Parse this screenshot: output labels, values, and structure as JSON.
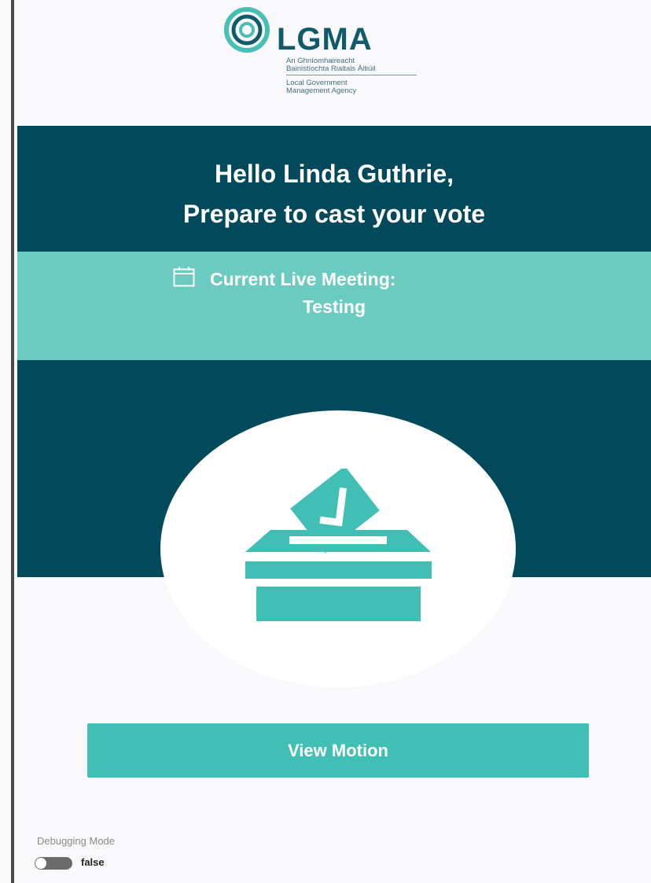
{
  "logo": {
    "name": "LGMA",
    "sub_irish_1": "An Ghníomhaireacht",
    "sub_irish_2": "Bainistíochta Rialtais Áitiúil",
    "sub_english_1": "Local Government",
    "sub_english_2": "Management Agency"
  },
  "greeting": {
    "line1": "Hello Linda Guthrie,",
    "line2": "Prepare to cast your vote"
  },
  "meeting": {
    "label": "Current Live Meeting:",
    "value": "Testing"
  },
  "actions": {
    "view_motion_label": "View Motion"
  },
  "debug": {
    "label": "Debugging Mode",
    "value": "false"
  },
  "icons": {
    "logo": "lgma-logo-mark",
    "calendar": "calendar-icon",
    "ballot": "ballot-box-icon"
  },
  "colors": {
    "dark_teal": "#02495c",
    "light_teal": "#6ccbc1",
    "button_teal": "#41bfb5",
    "background": "#f9f9fc"
  }
}
